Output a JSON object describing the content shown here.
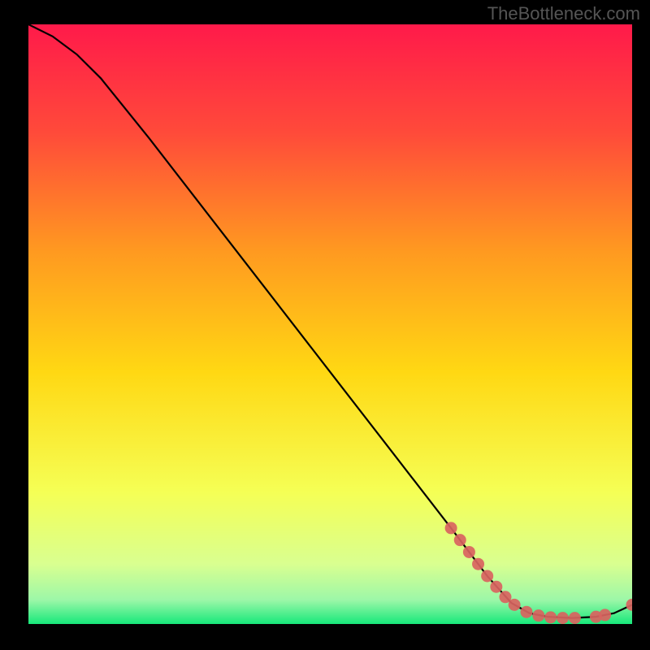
{
  "watermark": "TheBottleneck.com",
  "chart_data": {
    "type": "line",
    "title": "",
    "xlabel": "",
    "ylabel": "",
    "xlim": [
      0,
      100
    ],
    "ylim": [
      0,
      100
    ],
    "background_gradient": {
      "top": "#ff1a4a",
      "upper_mid": "#ff7a30",
      "mid": "#ffd813",
      "lower_mid": "#f2ff4a",
      "low": "#d4ff8a",
      "bottom": "#17e87a"
    },
    "curve": [
      {
        "x": 0,
        "y": 100
      },
      {
        "x": 4,
        "y": 98
      },
      {
        "x": 8,
        "y": 95
      },
      {
        "x": 12,
        "y": 91
      },
      {
        "x": 20,
        "y": 81
      },
      {
        "x": 30,
        "y": 68
      },
      {
        "x": 40,
        "y": 55
      },
      {
        "x": 50,
        "y": 42
      },
      {
        "x": 60,
        "y": 29
      },
      {
        "x": 70,
        "y": 16
      },
      {
        "x": 76,
        "y": 8
      },
      {
        "x": 80,
        "y": 3.5
      },
      {
        "x": 83,
        "y": 1.8
      },
      {
        "x": 86,
        "y": 1.2
      },
      {
        "x": 90,
        "y": 1.0
      },
      {
        "x": 94,
        "y": 1.2
      },
      {
        "x": 97,
        "y": 1.8
      },
      {
        "x": 100,
        "y": 3.2
      }
    ],
    "marker_segments": [
      {
        "points": [
          {
            "x": 70,
            "y": 16
          },
          {
            "x": 71.5,
            "y": 14
          },
          {
            "x": 73,
            "y": 12
          },
          {
            "x": 74.5,
            "y": 10
          },
          {
            "x": 76,
            "y": 8
          },
          {
            "x": 77.5,
            "y": 6.2
          },
          {
            "x": 79,
            "y": 4.5
          }
        ]
      },
      {
        "points": [
          {
            "x": 80.5,
            "y": 3.2
          },
          {
            "x": 82.5,
            "y": 2.0
          },
          {
            "x": 84.5,
            "y": 1.4
          },
          {
            "x": 86.5,
            "y": 1.1
          },
          {
            "x": 88.5,
            "y": 1.0
          },
          {
            "x": 90.5,
            "y": 1.0
          }
        ]
      },
      {
        "points": [
          {
            "x": 94,
            "y": 1.2
          },
          {
            "x": 95.5,
            "y": 1.5
          }
        ]
      },
      {
        "points": [
          {
            "x": 100,
            "y": 3.2
          }
        ]
      }
    ],
    "marker_color": "#d9635f",
    "curve_color": "#000000"
  }
}
